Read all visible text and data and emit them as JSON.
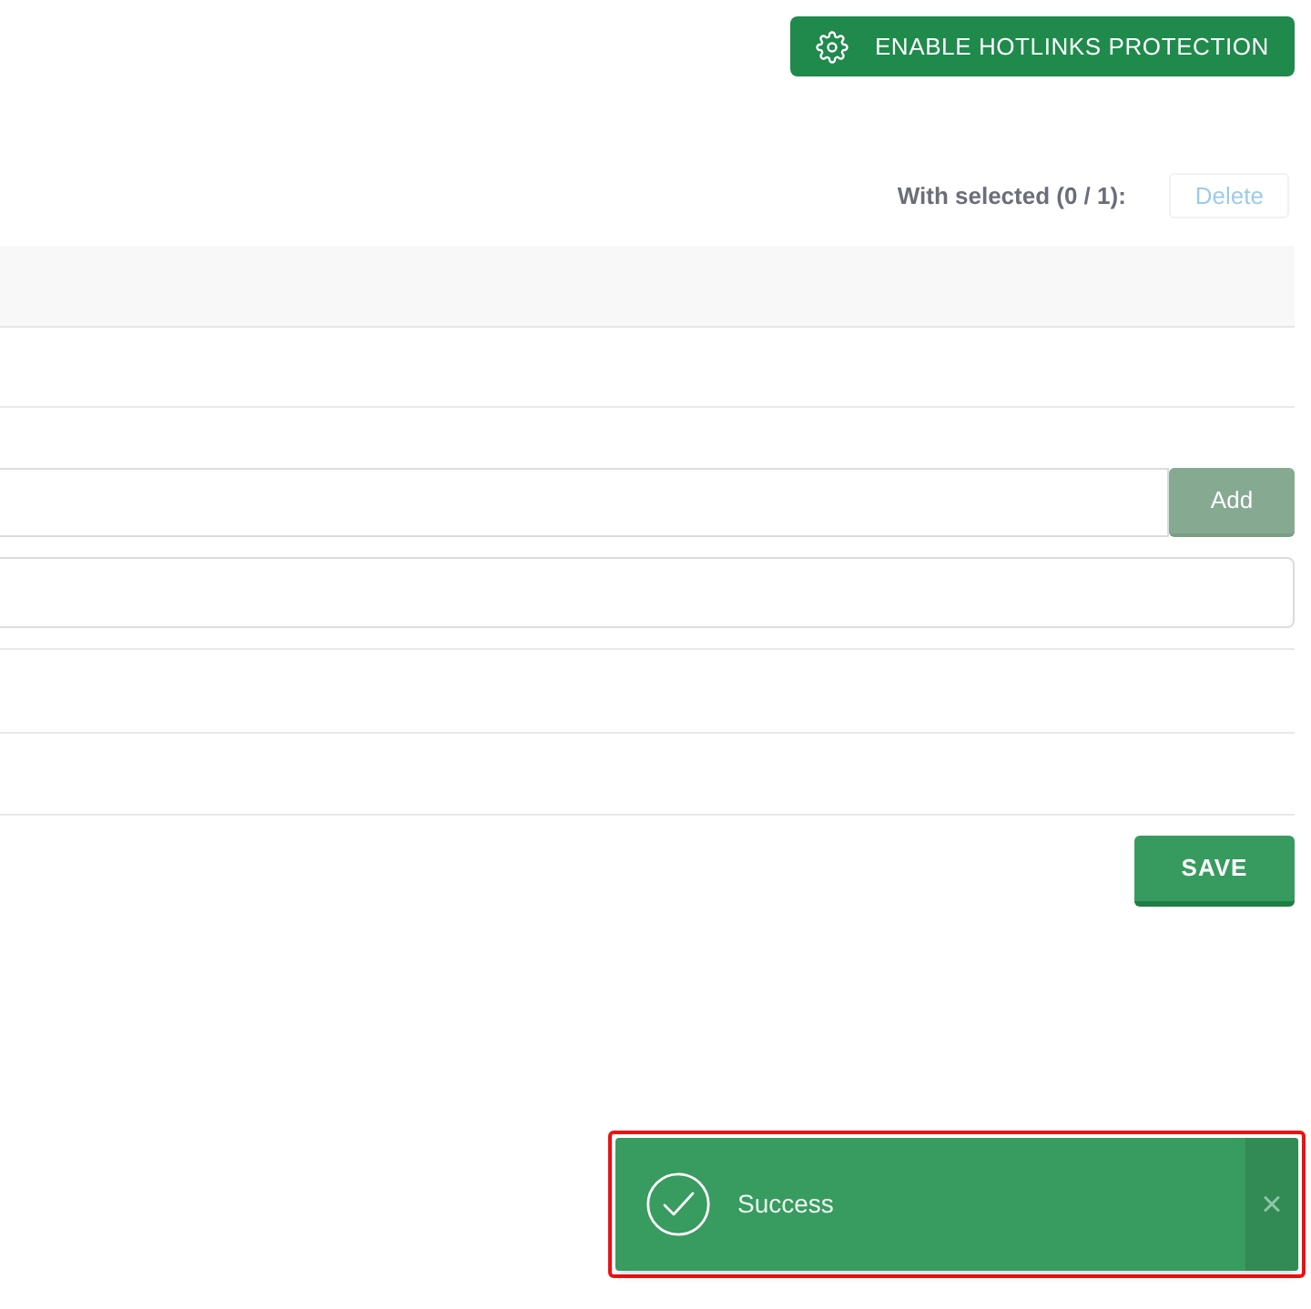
{
  "header": {
    "button": "ENABLE HOTLINKS PROTECTION"
  },
  "bulk_actions": {
    "label": "With selected (0 / 1):",
    "button": {
      "label": "Delete",
      "disabled": true
    }
  },
  "form": {
    "add_button": {
      "label": "Add",
      "disabled": true
    },
    "save_button": "SAVE"
  },
  "toast": {
    "message": "Success",
    "close": "×",
    "highlighted": true
  }
}
